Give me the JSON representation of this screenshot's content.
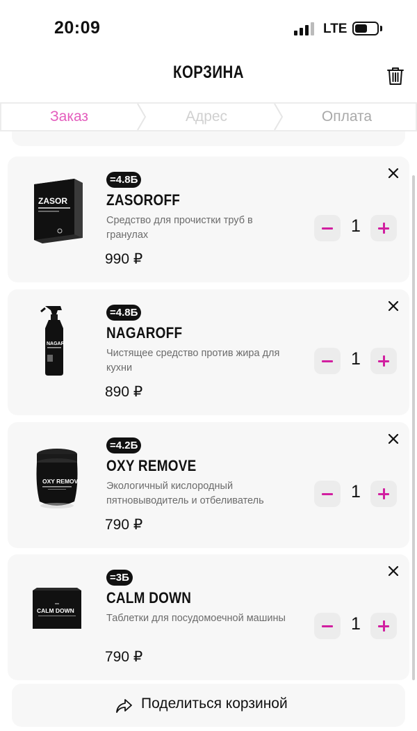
{
  "status_bar": {
    "time": "20:09",
    "network": "LTE"
  },
  "header": {
    "title": "КОРЗИНА",
    "trash_icon": "trash-icon"
  },
  "steps": [
    {
      "label": "Заказ",
      "state": "active"
    },
    {
      "label": "Адрес",
      "state": "inactive"
    },
    {
      "label": "Оплата",
      "state": "inactive"
    }
  ],
  "items": [
    {
      "badge": "=4.8Б",
      "name": "ZASOROFF",
      "description": "Средство для прочистки труб в гранулах",
      "price": "990 ₽",
      "quantity": "1",
      "image": "box-package"
    },
    {
      "badge": "=4.8Б",
      "name": "NAGAROFF",
      "description": "Чистящее средство против жира для кухни",
      "price": "890 ₽",
      "quantity": "1",
      "image": "spray-bottle"
    },
    {
      "badge": "=4.2Б",
      "name": "OXY REMOVE",
      "description": "Экологичный кислородный пятновыводитель и отбеливатель",
      "price": "790 ₽",
      "quantity": "1",
      "image": "jar"
    },
    {
      "badge": "=3Б",
      "name": "CALM DOWN",
      "description": "Таблетки для посудомоечной машины",
      "price": "790 ₽",
      "quantity": "1",
      "image": "flat-box"
    }
  ],
  "share": {
    "label": "Поделиться корзиной",
    "icon": "share-arrow-icon"
  },
  "colors": {
    "accent": "#e45dbd",
    "qty_control": "#d11fa0",
    "card_bg": "#f7f7f7",
    "badge_bg": "#111111"
  }
}
